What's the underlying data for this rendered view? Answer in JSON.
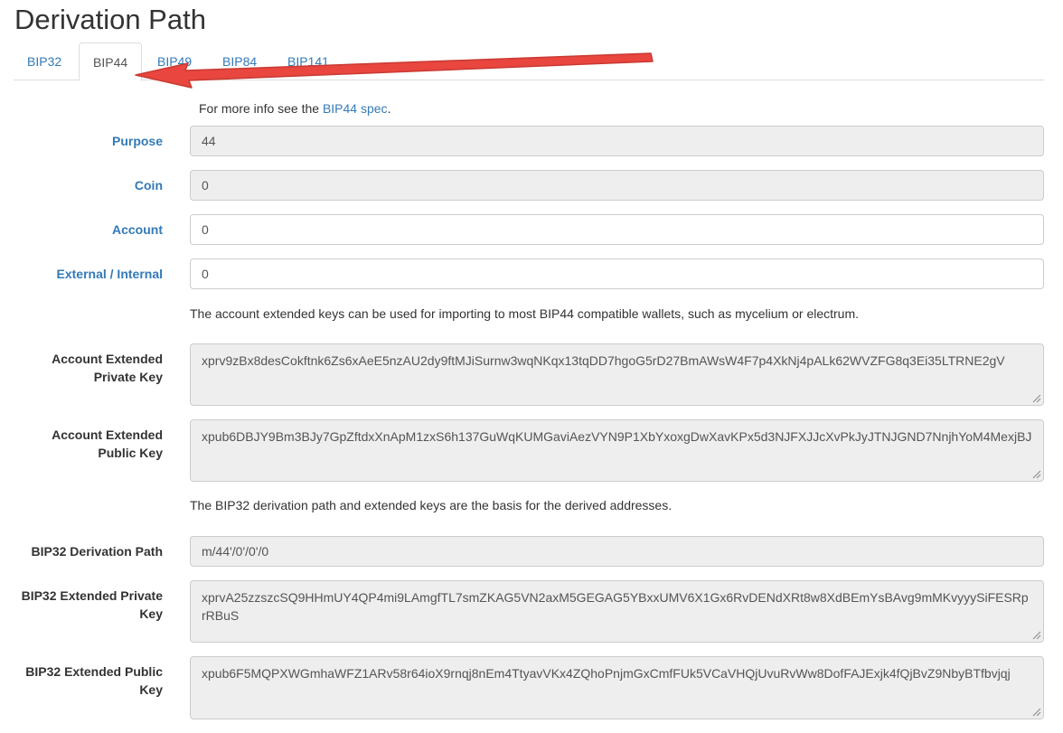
{
  "page_title": "Derivation Path",
  "tabs": [
    {
      "label": "BIP32",
      "active": false
    },
    {
      "label": "BIP44",
      "active": true
    },
    {
      "label": "BIP49",
      "active": false
    },
    {
      "label": "BIP84",
      "active": false
    },
    {
      "label": "BIP141",
      "active": false
    }
  ],
  "spec_info": {
    "prefix": "For more info see the ",
    "link": "BIP44 spec",
    "suffix": "."
  },
  "purpose": {
    "label": "Purpose",
    "value": "44"
  },
  "coin": {
    "label": "Coin",
    "value": "0"
  },
  "account": {
    "label": "Account",
    "value": "0"
  },
  "external_internal": {
    "label": "External / Internal",
    "value": "0"
  },
  "account_keys_note": "The account extended keys can be used for importing to most BIP44 compatible wallets, such as mycelium or electrum.",
  "account_xprv": {
    "label_line1": "Account Extended",
    "label_line2": "Private Key",
    "value": "xprv9zBx8desCokftnk6Zs6xAeE5nzAU2dy9ftMJiSurnw3wqNKqx13tqDD7hgoG5rD27BmAWsW4F7p4XkNj4pALk62WVZFG8q3Ei35LTRNE2gV"
  },
  "account_xpub": {
    "label_line1": "Account Extended",
    "label_line2": "Public Key",
    "value": "xpub6DBJY9Bm3BJy7GpZftdxXnApM1zxS6h137GuWqKUMGaviAezVYN9P1XbYxoxgDwXavKPx5d3NJFXJJcXvPkJyJTNJGND7NnjhYoM4MexjBJ"
  },
  "bip32_note": "The BIP32 derivation path and extended keys are the basis for the derived addresses.",
  "bip32_path": {
    "label": "BIP32 Derivation Path",
    "value": "m/44'/0'/0'/0"
  },
  "bip32_xprv": {
    "label_line1": "BIP32 Extended Private",
    "label_line2": "Key",
    "value": "xprvA25zzszcSQ9HHmUY4QP4mi9LAmgfTL7smZKAG5VN2axM5GEGAG5YBxxUMV6X1Gx6RvDENdXRt8w8XdBEmYsBAvg9mMKvyyySiFESRprRBuS"
  },
  "bip32_xpub": {
    "label_line1": "BIP32 Extended Public",
    "label_line2": "Key",
    "value": "xpub6F5MQPXWGmhaWFZ1ARv58r64ioX9rnqj8nEm4TtyavVKx4ZQhoPnjmGxCmfFUk5VCaVHQjUvuRvWw8DofFAJExjk4fQjBvZ9NbyBTfbvjqj"
  },
  "colors": {
    "link": "#337ab7",
    "arrow": "#e8463f",
    "readonly_bg": "#eeeeee"
  }
}
